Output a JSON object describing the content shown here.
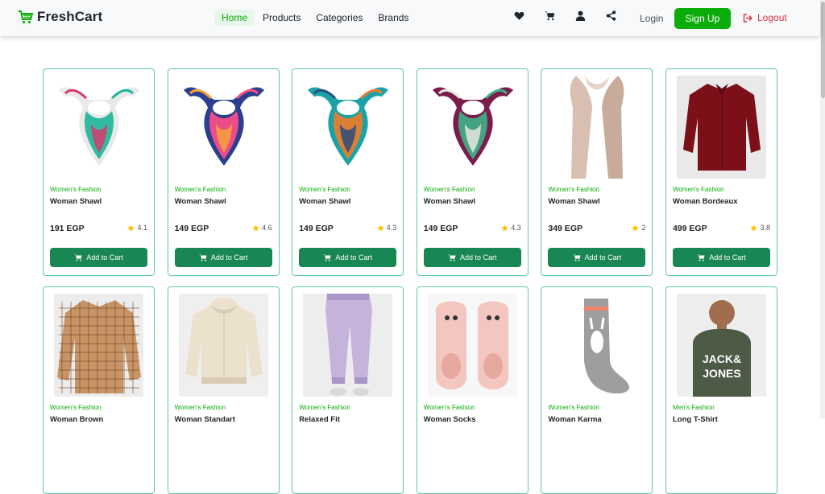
{
  "brand": {
    "name": "FreshCart",
    "accent": "#0aad0a"
  },
  "nav": {
    "links": [
      {
        "label": "Home",
        "active": true
      },
      {
        "label": "Products",
        "active": false
      },
      {
        "label": "Categories",
        "active": false
      },
      {
        "label": "Brands",
        "active": false
      }
    ],
    "icons": [
      "heart-icon",
      "cart-icon",
      "user-icon",
      "share-icon"
    ],
    "login_label": "Login",
    "signup_label": "Sign Up",
    "logout_label": "Logout"
  },
  "products": [
    {
      "category": "Women's Fashion",
      "title": "Woman Shawl",
      "price": "191 EGP",
      "rating": "4.1",
      "button": "Add to Cart",
      "image": "scarf-white-floral",
      "colors": [
        "#e9e9e9",
        "#1db59a",
        "#d63a6b"
      ]
    },
    {
      "category": "Women's Fashion",
      "title": "Woman Shawl",
      "price": "149 EGP",
      "rating": "4.6",
      "button": "Add to Cart",
      "image": "scarf-pink-blue",
      "colors": [
        "#2c3e8f",
        "#ff4f87",
        "#f6a23b"
      ]
    },
    {
      "category": "Women's Fashion",
      "title": "Woman Shawl",
      "price": "149 EGP",
      "rating": "4.3",
      "button": "Add to Cart",
      "image": "scarf-orange-teal",
      "colors": [
        "#1aa3a7",
        "#f07b2a",
        "#2a4c7d"
      ]
    },
    {
      "category": "Women's Fashion",
      "title": "Woman Shawl",
      "price": "149 EGP",
      "rating": "4.3",
      "button": "Add to Cart",
      "image": "scarf-purple-green",
      "colors": [
        "#7a1d4d",
        "#3fb28a",
        "#e8e6e0"
      ]
    },
    {
      "category": "Women's Fashion",
      "title": "Woman Shawl",
      "price": "349 EGP",
      "rating": "2",
      "button": "Add to Cart",
      "image": "scarf-beige-long",
      "colors": [
        "#d8bfb1",
        "#c9ab9b",
        "#e6d4ca"
      ]
    },
    {
      "category": "Women's Fashion",
      "title": "Woman Bordeaux",
      "price": "499 EGP",
      "rating": "3.8",
      "button": "Add to Cart",
      "image": "shirt-bordeaux",
      "colors": [
        "#7b1019",
        "#5f0a12",
        "#e9e9e9"
      ]
    },
    {
      "category": "Women's Fashion",
      "title": "Woman Brown",
      "price": "",
      "rating": "",
      "button": "",
      "image": "shirt-brown-plaid",
      "colors": [
        "#c89466",
        "#6b4226",
        "#ececec"
      ]
    },
    {
      "category": "Women's Fashion",
      "title": "Woman Standart",
      "price": "",
      "rating": "",
      "button": "",
      "image": "hoodie-cream",
      "colors": [
        "#ece1cd",
        "#d9ccb4",
        "#efefef"
      ]
    },
    {
      "category": "Women's Fashion",
      "title": "Relaxed Fit",
      "price": "",
      "rating": "",
      "button": "",
      "image": "joggers-lilac",
      "colors": [
        "#c6b3dc",
        "#a995c7",
        "#ededed"
      ]
    },
    {
      "category": "Women's Fashion",
      "title": "Woman Socks",
      "price": "",
      "rating": "",
      "button": "",
      "image": "slipper-socks-pink",
      "colors": [
        "#f3c7c0",
        "#e6a9a0",
        "#f7f7f7"
      ]
    },
    {
      "category": "Women's Fashion",
      "title": "Woman Karma",
      "price": "",
      "rating": "",
      "button": "",
      "image": "sock-grey-bunny",
      "colors": [
        "#9e9e9e",
        "#f0856b",
        "#ffffff"
      ]
    },
    {
      "category": "Men's Fashion",
      "title": "Long T-Shirt",
      "price": "",
      "rating": "",
      "button": "",
      "image": "tshirt-jack-jones",
      "colors": [
        "#4d5a45",
        "#ffffff",
        "#a06e4f"
      ]
    }
  ]
}
